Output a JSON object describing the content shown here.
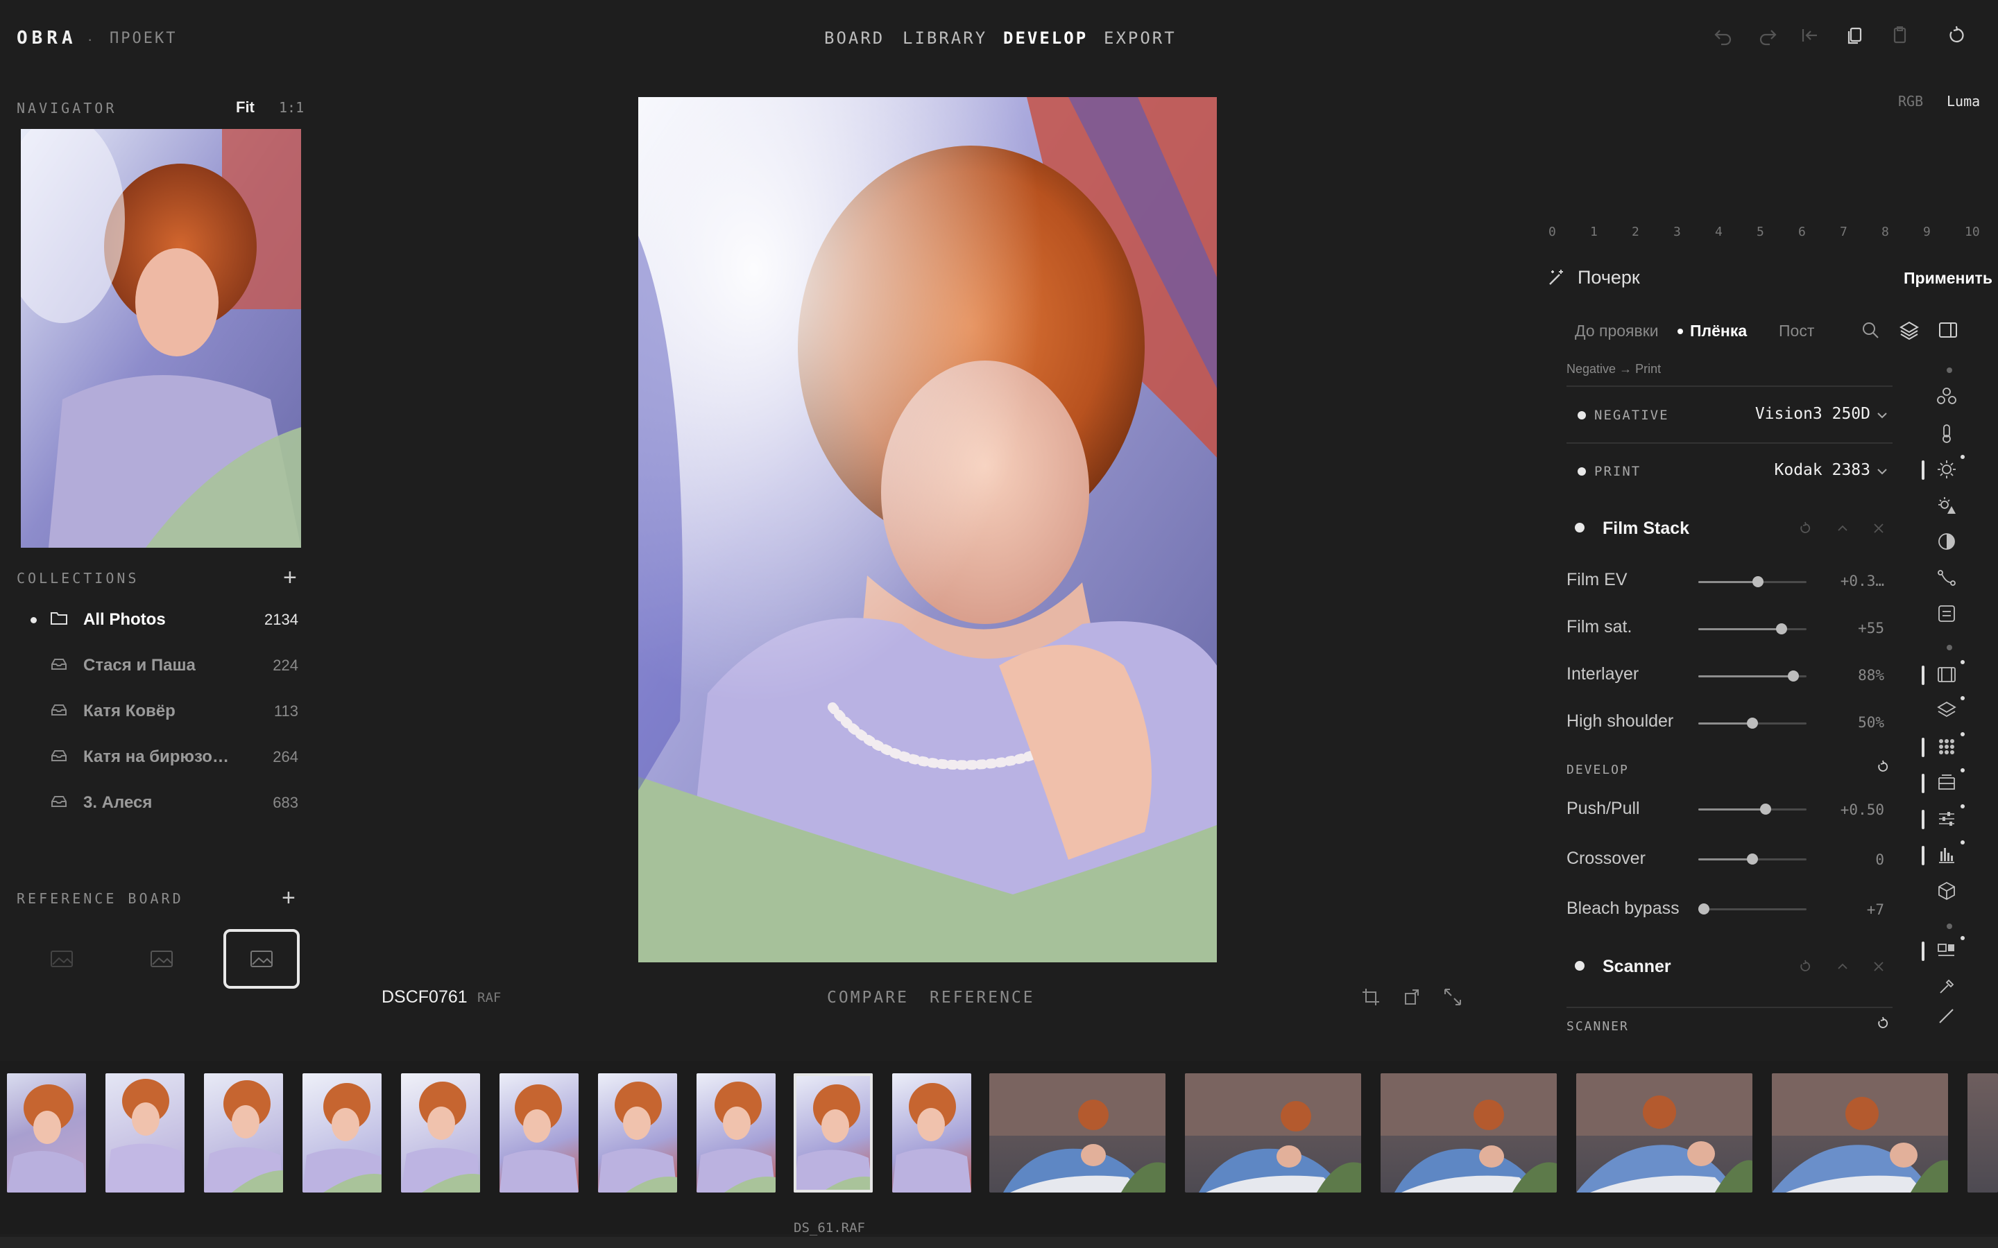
{
  "app": {
    "brand": "OBRA",
    "separator": "·",
    "project": "ПРОЕКТ"
  },
  "nav": {
    "tabs": [
      {
        "label": "BOARD",
        "active": false
      },
      {
        "label": "LIBRARY",
        "active": false
      },
      {
        "label": "DEVELOP",
        "active": true
      },
      {
        "label": "EXPORT",
        "active": false
      }
    ]
  },
  "toolbar_icons": [
    "undo-icon",
    "redo-icon",
    "first-icon",
    "copy-icon",
    "paste-icon",
    "reset-icon"
  ],
  "navigator": {
    "title": "NAVIGATOR",
    "fit": "Fit",
    "one_to_one": "1:1"
  },
  "collections": {
    "title": "COLLECTIONS",
    "add": "+",
    "items": [
      {
        "label": "All Photos",
        "count": "2134",
        "active": true,
        "icon": "folder-icon"
      },
      {
        "label": "Стася и Паша",
        "count": "224",
        "active": false,
        "icon": "stack-icon"
      },
      {
        "label": "Катя Ковёр",
        "count": "113",
        "active": false,
        "icon": "stack-icon"
      },
      {
        "label": "Катя на бирюзо…",
        "count": "264",
        "active": false,
        "icon": "stack-icon"
      },
      {
        "label": "3. Алеся",
        "count": "683",
        "active": false,
        "icon": "stack-icon"
      }
    ]
  },
  "reference_board": {
    "title": "REFERENCE BOARD",
    "add": "+"
  },
  "image": {
    "filename": "DSCF0761",
    "ext": "RAF"
  },
  "viewer_actions": {
    "compare": "COMPARE",
    "reference": "REFERENCE"
  },
  "histogram": {
    "rgb": "RGB",
    "luma": "Luma",
    "scale": [
      "0",
      "1",
      "2",
      "3",
      "4",
      "5",
      "6",
      "7",
      "8",
      "9",
      "10"
    ]
  },
  "preset": {
    "name": "Почерк",
    "apply": "Применить"
  },
  "stages": {
    "items": [
      {
        "label": "До проявки",
        "active": false
      },
      {
        "label": "Плёнка",
        "active": true
      },
      {
        "label": "Пост",
        "active": false
      }
    ]
  },
  "pipeline": {
    "from": "Negative",
    "arrow": "→",
    "to": "Print"
  },
  "negative": {
    "label": "NEGATIVE",
    "value": "Vision3 250D"
  },
  "print": {
    "label": "PRINT",
    "value": "Kodak 2383"
  },
  "film_stack": {
    "title": "Film Stack",
    "sliders": [
      {
        "label": "Film EV",
        "value": "+0.3…",
        "level": 0.55
      },
      {
        "label": "Film sat.",
        "value": "+55",
        "level": 0.77
      },
      {
        "label": "Interlayer",
        "value": "88%",
        "level": 0.88
      },
      {
        "label": "High shoulder",
        "value": "50%",
        "level": 0.5
      }
    ]
  },
  "develop": {
    "title": "DEVELOP",
    "sliders": [
      {
        "label": "Push/Pull",
        "value": "+0.50",
        "level": 0.62
      },
      {
        "label": "Crossover",
        "value": "0",
        "level": 0.5
      },
      {
        "label": "Bleach bypass",
        "value": "+7",
        "level": 0.05
      }
    ]
  },
  "scanner": {
    "title": "Scanner",
    "section": "SCANNER"
  },
  "filmstrip": {
    "selected_label": "DS_61.RAF"
  },
  "colors": {
    "bg": "#1e1e1e",
    "panel": "#1e1e1e",
    "accent": "#ffffff",
    "muted": "#8a8a8a"
  }
}
